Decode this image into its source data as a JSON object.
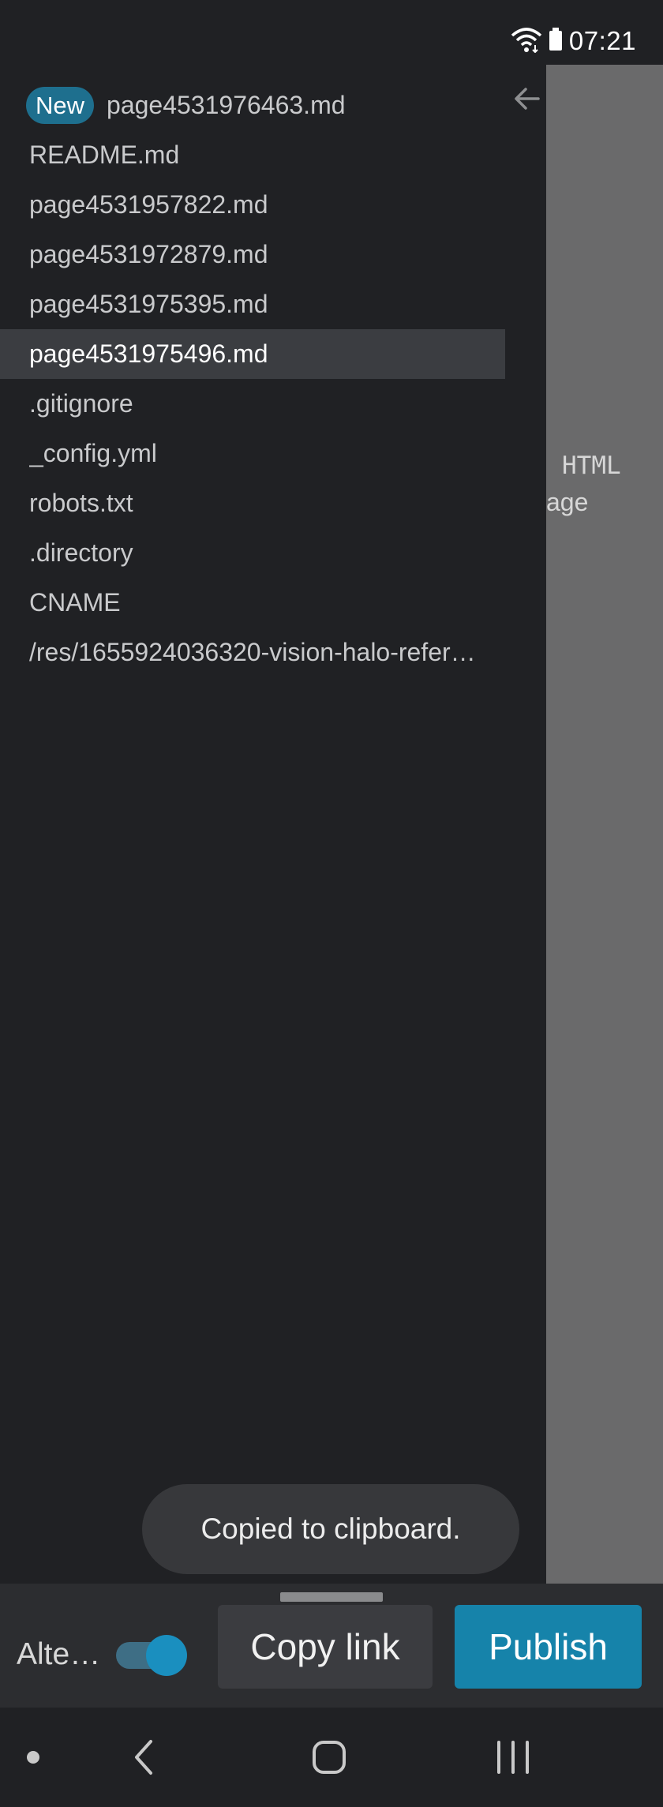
{
  "status_bar": {
    "time": "07:21",
    "icons": [
      "wifi-icon",
      "battery-icon"
    ]
  },
  "drawer": {
    "new_badge": "New",
    "files": [
      "page4531976463.md",
      "README.md",
      "page4531957822.md",
      "page4531972879.md",
      "page4531975395.md",
      "page4531975496.md",
      ".gitignore",
      "_config.yml",
      "robots.txt",
      ".directory",
      "CNAME",
      "/res/1655924036320-vision-halo-refer…"
    ],
    "selected_index": 5
  },
  "preview": {
    "line1": "HTML",
    "line2": "age"
  },
  "toast": {
    "message": "Copied to clipboard."
  },
  "action_bar": {
    "alt_label": "Alte…",
    "toggle_on": true,
    "copy_link_label": "Copy link",
    "publish_label": "Publish"
  },
  "colors": {
    "background": "#202124",
    "accent": "#1683aa",
    "badge": "#1e6f8e",
    "selected_row": "#3b3d41",
    "preview_pane": "#6a6a6b"
  },
  "nav_bar": {
    "icons": [
      "dot-icon",
      "back-icon",
      "home-icon",
      "recents-icon"
    ]
  }
}
